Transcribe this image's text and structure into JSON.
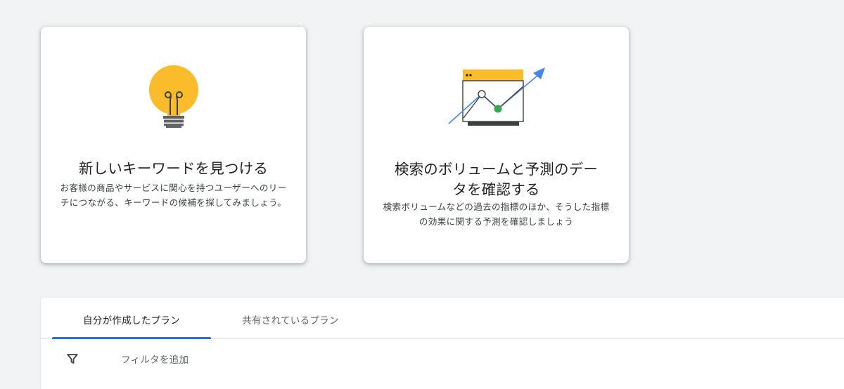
{
  "cards": [
    {
      "title": "新しいキーワードを見つける",
      "description": "お客様の商品やサービスに関心を持つユーザーへのリーチにつながる、キーワードの候補を探してみましょう。",
      "icon": "lightbulb-icon"
    },
    {
      "title": "検索のボリュームと予測のデータを確認する",
      "description": "検索ボリュームなどの過去の指標のほか、そうした指標の効果に関する予測を確認しましょう",
      "icon": "trend-chart-icon"
    }
  ],
  "plans": {
    "tabs": [
      {
        "label": "自分が作成したプラン",
        "selected": true
      },
      {
        "label": "共有されているプラン",
        "selected": false
      }
    ],
    "filter": {
      "icon": "filter-icon",
      "label": "フィルタを追加"
    }
  },
  "colors": {
    "background": "#f1f3f4",
    "accent": "#1a73e8",
    "bulb": "#fbbc2c",
    "chart_header": "#fbbc2c",
    "chart_point": "#34a853",
    "arrow": "#4285f4"
  }
}
